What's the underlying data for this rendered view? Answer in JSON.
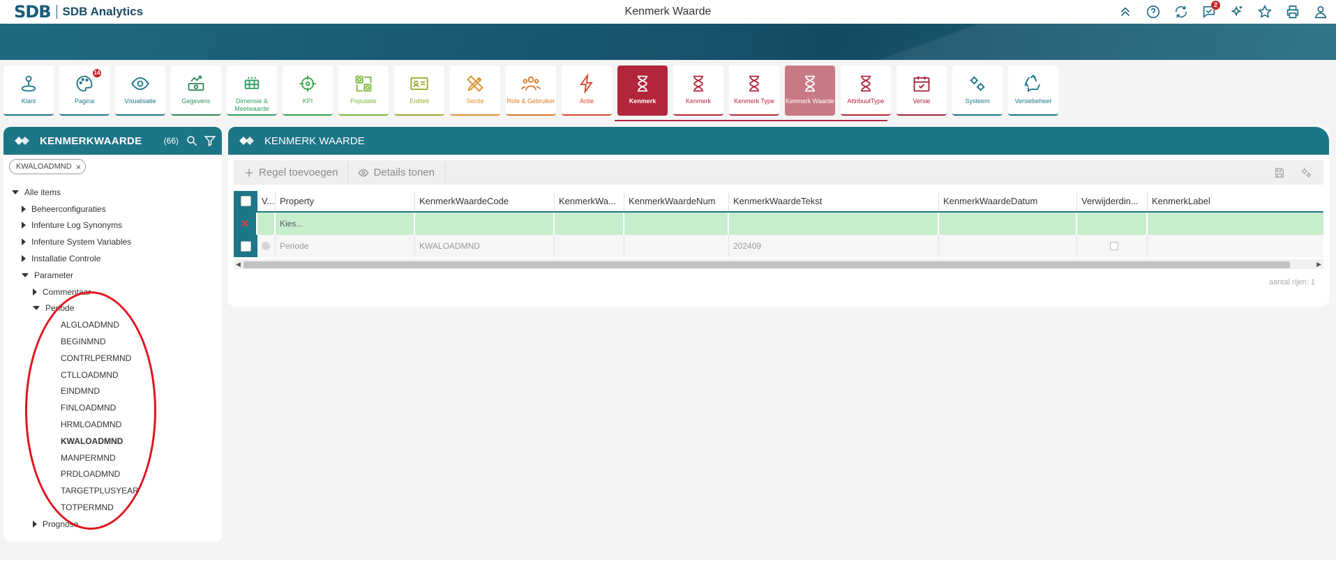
{
  "app": {
    "logo_mark": "SDB",
    "logo_text": "SDB Analytics",
    "page_title": "Kenmerk Waarde"
  },
  "top_icons": [
    {
      "name": "collapse-up-icon"
    },
    {
      "name": "help-icon"
    },
    {
      "name": "refresh-icon"
    },
    {
      "name": "messages-icon",
      "badge": "2"
    },
    {
      "name": "sparkle-star-icon"
    },
    {
      "name": "favorite-star-icon"
    },
    {
      "name": "print-icon"
    },
    {
      "name": "user-icon"
    }
  ],
  "nav": [
    {
      "label": "Klant",
      "color": "#1d7588",
      "icon": "user-pin-icon"
    },
    {
      "label": "Pagina",
      "color": "#1d7588",
      "icon": "palette-icon",
      "badge": "14"
    },
    {
      "label": "Visualisatie",
      "color": "#1d7588",
      "icon": "eye-icon"
    },
    {
      "label": "Gegevens",
      "color": "#2e8b57",
      "icon": "money-icon"
    },
    {
      "label": "Dimensie & Meetwaarde",
      "color": "#2e9e5e",
      "icon": "dimension-icon"
    },
    {
      "label": "KPI",
      "color": "#3aa64a",
      "icon": "target-icon"
    },
    {
      "label": "Populatie",
      "color": "#7ab83a",
      "icon": "population-icon"
    },
    {
      "label": "Entiteit",
      "color": "#a0a82a",
      "icon": "id-card-icon"
    },
    {
      "label": "Sectie",
      "color": "#d9922a",
      "icon": "pencil-ruler-icon"
    },
    {
      "label": "Role & Gebruiker",
      "color": "#d9782a",
      "icon": "users-icon"
    },
    {
      "label": "Actie",
      "color": "#d9452a",
      "icon": "lightning-icon"
    },
    {
      "label": "Kenmerk",
      "color": "#b3253b",
      "icon": "hourglass-icon",
      "state": "active"
    },
    {
      "label": "Kenmerk",
      "color": "#b3253b",
      "icon": "hourglass-icon"
    },
    {
      "label": "Kenmerk Type",
      "color": "#b3253b",
      "icon": "hourglass-icon"
    },
    {
      "label": "Kenmerk Waarde",
      "color": "#b3253b",
      "icon": "hourglass-icon",
      "state": "current"
    },
    {
      "label": "AttribuutType",
      "color": "#b3253b",
      "icon": "hourglass-icon"
    },
    {
      "label": "Versie",
      "color": "#a0233a",
      "icon": "calendar-check-icon"
    },
    {
      "label": "Systeem",
      "color": "#1d7588",
      "icon": "gears-icon"
    },
    {
      "label": "Versiebeheer",
      "color": "#1d7588",
      "icon": "recycle-icon"
    }
  ],
  "left_panel": {
    "title": "KENMERKWAARDE",
    "count": "(66)",
    "filter_chip": "KWALOADMND",
    "tree": [
      {
        "label": "Alle items",
        "level": 0,
        "caret": "down"
      },
      {
        "label": "Beheerconfiguraties",
        "level": 1,
        "caret": "right"
      },
      {
        "label": "Infenture Log Synonyms",
        "level": 1,
        "caret": "right"
      },
      {
        "label": "Infenture System Variables",
        "level": 1,
        "caret": "right"
      },
      {
        "label": "Installatie Controle",
        "level": 1,
        "caret": "right"
      },
      {
        "label": "Parameter",
        "level": 1,
        "caret": "down"
      },
      {
        "label": "Commentaar",
        "level": 2,
        "caret": "right"
      },
      {
        "label": "Periode",
        "level": 2,
        "caret": "down"
      },
      {
        "label": "ALGLOADMND",
        "level": 3
      },
      {
        "label": "BEGINMND",
        "level": 3
      },
      {
        "label": "CONTRLPERMND",
        "level": 3
      },
      {
        "label": "CTLLOADMND",
        "level": 3
      },
      {
        "label": "EINDMND",
        "level": 3
      },
      {
        "label": "FINLOADMND",
        "level": 3
      },
      {
        "label": "HRMLOADMND",
        "level": 3
      },
      {
        "label": "KWALOADMND",
        "level": 3,
        "selected": true
      },
      {
        "label": "MANPERMND",
        "level": 3
      },
      {
        "label": "PRDLOADMND",
        "level": 3
      },
      {
        "label": "TARGETPLUSYEAR",
        "level": 3
      },
      {
        "label": "TOTPERMND",
        "level": 3
      },
      {
        "label": "Prognose",
        "level": 2,
        "caret": "right"
      }
    ]
  },
  "right_panel": {
    "title": "KENMERK WAARDE",
    "add_row_label": "Regel toevoegen",
    "details_label": "Details tonen",
    "columns": [
      "V...",
      "Property",
      "KenmerkWaardeCode",
      "KenmerkWa...",
      "KenmerkWaardeNum",
      "KenmerkWaardeTekst",
      "KenmerkWaardeDatum",
      "Verwijderdin...",
      "KenmerkLabel"
    ],
    "new_row": {
      "property_placeholder": "Kies..."
    },
    "rows": [
      {
        "property": "Periode",
        "code": "KWALOADMND",
        "wa": "",
        "num": "",
        "tekst": "202409",
        "datum": "",
        "label": ""
      }
    ],
    "row_count": "aantal rijen: 1"
  }
}
